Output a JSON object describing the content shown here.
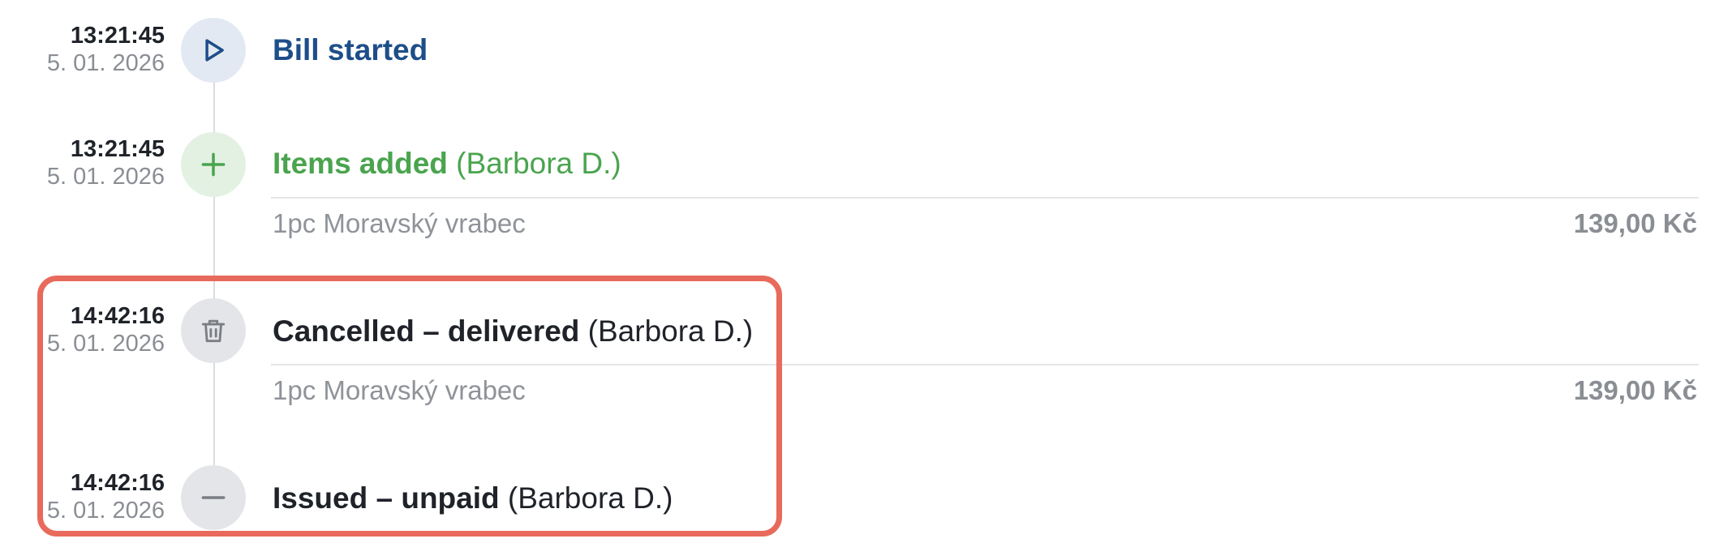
{
  "events": [
    {
      "time": "13:21:45",
      "date": "5. 01. 2026",
      "icon": "play-icon",
      "title_bold": "Bill started",
      "title_normal": "",
      "title_color": "#1d4e89",
      "node_color": "#e3e9f2"
    },
    {
      "time": "13:21:45",
      "date": "5. 01. 2026",
      "icon": "plus-icon",
      "title_bold": "Items added",
      "title_normal": " (Barbora D.)",
      "title_color": "#4aa44e",
      "node_color": "#e3f1e3",
      "item": {
        "description": "1pc Moravský vrabec",
        "price": "139,00 Kč"
      }
    },
    {
      "time": "14:42:16",
      "date": "5. 01. 2026",
      "icon": "trash-icon",
      "title_bold": "Cancelled – delivered",
      "title_normal": " (Barbora D.)",
      "title_color": "#1f2329",
      "node_color": "#e4e5e8",
      "item": {
        "description": "1pc Moravský vrabec",
        "price": "139,00 Kč"
      }
    },
    {
      "time": "14:42:16",
      "date": "5. 01. 2026",
      "icon": "minus-icon",
      "title_bold": "Issued – unpaid",
      "title_normal": " (Barbora D.)",
      "title_color": "#1f2329",
      "node_color": "#e4e5e8"
    }
  ],
  "highlight_color": "#e86a5c"
}
